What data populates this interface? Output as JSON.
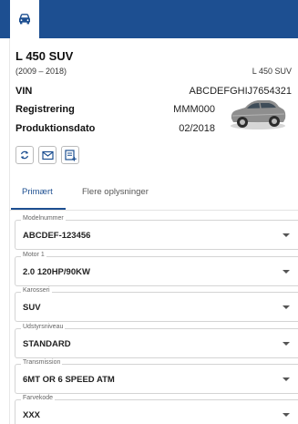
{
  "header": {
    "icon": "car-icon",
    "accent_color": "#1d4f91"
  },
  "vehicle": {
    "title": "L 450 SUV",
    "years": "(2009 – 2018)",
    "model_short": "L 450 SUV",
    "info": [
      {
        "label": "VIN",
        "value": "ABCDEFGHIJ7654321"
      },
      {
        "label": "Registrering",
        "value": "MMM000"
      },
      {
        "label": "Produktionsdato",
        "value": "02/2018"
      }
    ]
  },
  "actions": [
    {
      "icon": "refresh-icon"
    },
    {
      "icon": "mail-icon"
    },
    {
      "icon": "note-add-icon"
    }
  ],
  "tabs": [
    {
      "label": "Primært",
      "active": true
    },
    {
      "label": "Flere oplysninger",
      "active": false
    }
  ],
  "fields": [
    {
      "label": "Modelnummer",
      "value": "ABCDEF-123456"
    },
    {
      "label": "Motor 1",
      "value": "2.0 120HP/90KW"
    },
    {
      "label": "Karosseri",
      "value": "SUV"
    },
    {
      "label": "Udstyrsniveau",
      "value": "STANDARD"
    },
    {
      "label": "Transmission",
      "value": "6MT OR 6 SPEED ATM"
    },
    {
      "label": "Farvekode",
      "value": "XXX"
    }
  ]
}
